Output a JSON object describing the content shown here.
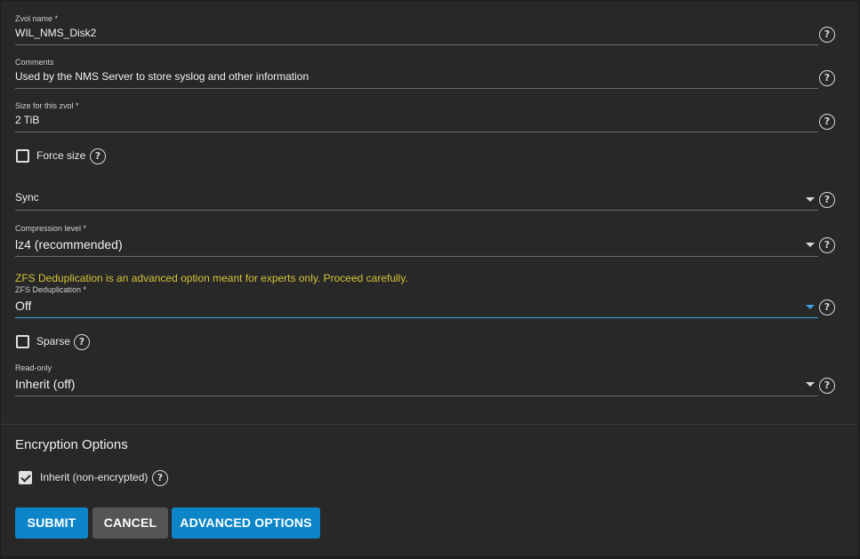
{
  "fields": {
    "zvol_name": {
      "label": "Zvol name *",
      "value": "WIL_NMS_Disk2"
    },
    "comments": {
      "label": "Comments",
      "value": "Used by the NMS Server to store syslog and other information"
    },
    "size": {
      "label": "Size for this zvol *",
      "value": "2 TiB"
    },
    "force_size": {
      "label": "Force size",
      "checked": false
    },
    "sync": {
      "label": "",
      "value": "Sync"
    },
    "compression": {
      "label": "Compression level *",
      "value": "lz4 (recommended)"
    },
    "dedup_warning": "ZFS Deduplication is an advanced option meant for experts only. Proceed carefully.",
    "dedup": {
      "label": "ZFS Deduplication *",
      "value": "Off"
    },
    "sparse": {
      "label": "Sparse",
      "checked": false
    },
    "readonly": {
      "label": "Read-only",
      "value": "Inherit (off)"
    }
  },
  "encryption": {
    "title": "Encryption Options",
    "inherit": {
      "label": "Inherit (non-encrypted)",
      "checked": true
    }
  },
  "buttons": {
    "submit": "SUBMIT",
    "cancel": "CANCEL",
    "advanced": "ADVANCED OPTIONS"
  },
  "icons": {
    "help": "help-circle-icon",
    "dropdown": "caret-down-icon",
    "check": "check-icon"
  },
  "colors": {
    "accent": "#0d86c9",
    "warning": "#d4c33a",
    "background": "#282828"
  }
}
